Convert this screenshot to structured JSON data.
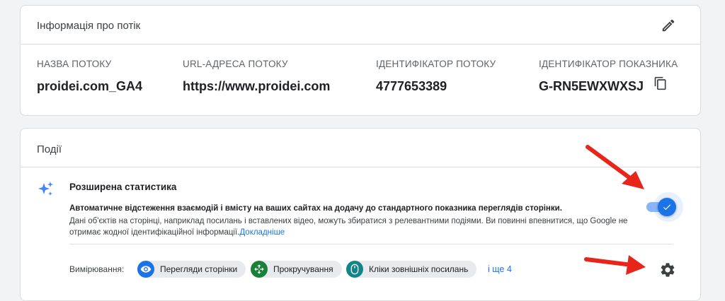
{
  "stream_info": {
    "title": "Інформація про потік",
    "fields": [
      {
        "label": "НАЗВА ПОТОКУ",
        "value": "proidei.com_GA4"
      },
      {
        "label": "URL-АДРЕСА ПОТОКУ",
        "value": "https://www.proidei.com"
      },
      {
        "label": "ІДЕНТИФІКАТОР ПОТОКУ",
        "value": "4777653389"
      },
      {
        "label": "ІДЕНТИФІКАТОР ПОКАЗНИКА",
        "value": "G-RN5EWXWXSJ"
      }
    ]
  },
  "events": {
    "title": "Події",
    "enhanced": {
      "title": "Розширена статистика",
      "desc_bold": "Автоматичне відстеження взаємодій і вмісту на ваших сайтах на додачу до стандартного показника переглядів сторінки.",
      "desc": "Дані об'єктів на сторінці, наприклад посилань і вставлених відео, можуть збиратися з релевантними подіями. Ви повинні впевнитися, що Google не отримає жодної ідентифікаційної інформації.",
      "more_link": "Докладніше",
      "enabled": true
    },
    "measuring_label": "Вимірювання:",
    "chips": [
      {
        "label": "Перегляди сторінки",
        "icon": "eye-icon",
        "color": "#1a73e8"
      },
      {
        "label": "Прокручування",
        "icon": "scroll-arrows-icon",
        "color": "#188038"
      },
      {
        "label": "Кліки зовнішніх посилань",
        "icon": "mouse-icon",
        "color": "#12858a"
      }
    ],
    "more_chips": "і ще 4"
  },
  "colors": {
    "accent": "#1a73e8",
    "annotation_arrow": "#e8251b"
  }
}
